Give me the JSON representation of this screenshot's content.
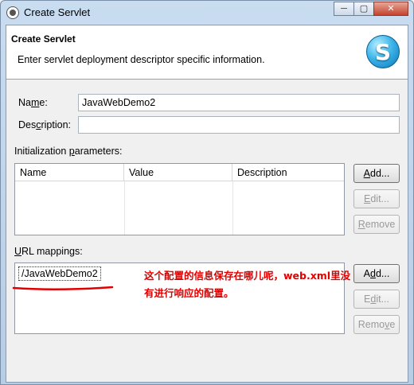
{
  "window": {
    "title": "Create Servlet",
    "minimize_glyph": "─",
    "maximize_glyph": "▢",
    "close_glyph": "✕"
  },
  "banner": {
    "title": "Create Servlet",
    "description": "Enter servlet deployment descriptor specific information.",
    "logo_letter": "S"
  },
  "form": {
    "name_label_pre": "Na",
    "name_label_mnemonic": "m",
    "name_label_post": "e:",
    "name_value": "JavaWebDemo2",
    "description_label_pre": "Des",
    "description_label_mnemonic": "c",
    "description_label_post": "ription:",
    "description_value": ""
  },
  "init_params": {
    "label_pre": "Initialization ",
    "label_mnemonic": "p",
    "label_post": "arameters:",
    "columns": [
      "Name",
      "Value",
      "Description"
    ],
    "rows": [],
    "add_pre": "",
    "add_mnemonic": "A",
    "add_post": "dd...",
    "edit_pre": "",
    "edit_mnemonic": "E",
    "edit_post": "dit...",
    "remove_pre": "",
    "remove_mnemonic": "R",
    "remove_post": "emove"
  },
  "url_mappings": {
    "label_pre": "",
    "label_mnemonic": "U",
    "label_post": "RL mappings:",
    "items": [
      "/JavaWebDemo2"
    ],
    "add_pre": "A",
    "add_mnemonic": "d",
    "add_post": "d...",
    "edit_pre": "E",
    "edit_mnemonic": "d",
    "edit_post": "it...",
    "remove_pre": "Remo",
    "remove_mnemonic": "v",
    "remove_post": "e"
  },
  "annotation": {
    "text": "这个配置的信息保存在哪儿呢，web.xml里没有进行响应的配置。",
    "color": "#e00000"
  }
}
